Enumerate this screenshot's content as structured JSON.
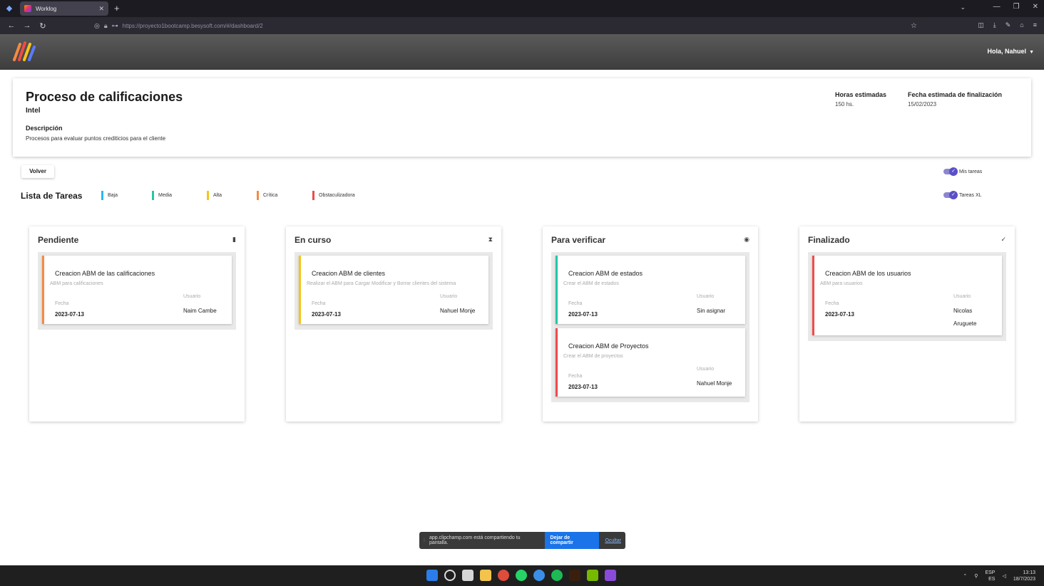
{
  "browser": {
    "tab_title": "Worklog",
    "url": "https://proyecto1bootcamp.besysoft.com/#/dashboard/2"
  },
  "header": {
    "greeting": "Hola, Nahuel"
  },
  "project": {
    "title": "Proceso de calificaciones",
    "client": "Intel",
    "description_label": "Descripción",
    "description": "Procesos para evaluar puntos crediticios para el cliente",
    "hours_label": "Horas estimadas",
    "hours_value": "150 hs.",
    "end_label": "Fecha estimada de finalización",
    "end_value": "15/02/2023"
  },
  "actions": {
    "back_label": "Volver"
  },
  "task_list": {
    "title": "Lista de Tareas",
    "legend": [
      {
        "label": "Baja",
        "color": "#29b6f6"
      },
      {
        "label": "Media",
        "color": "#26c6a6"
      },
      {
        "label": "Alta",
        "color": "#f5c518"
      },
      {
        "label": "Crítica",
        "color": "#f58a42"
      },
      {
        "label": "Obstaculizadora",
        "color": "#ef4b4b"
      }
    ],
    "toggle_my_tasks": "Mis tareas",
    "toggle_xl": "Tareas XL"
  },
  "columns": [
    {
      "title": "Pendiente",
      "icon": "file-icon",
      "tasks": [
        {
          "title": "Creacion ABM de las calificaciones",
          "desc": "ABM para calificaciones",
          "date_label": "Fecha",
          "date": "2023-07-13",
          "user_label": "Usuario",
          "user": "Naim Cambe",
          "color": "#f58a42"
        }
      ]
    },
    {
      "title": "En curso",
      "icon": "hourglass-icon",
      "tasks": [
        {
          "title": "Creacion ABM de clientes",
          "desc": "Realizar el ABM para Cargar Modificar y Borrar clientes del sistema",
          "date_label": "Fecha",
          "date": "2023-07-13",
          "user_label": "Usuario",
          "user": "Nahuel Monje",
          "color": "#f5c518"
        }
      ]
    },
    {
      "title": "Para verificar",
      "icon": "eye-icon",
      "tasks": [
        {
          "title": "Creacion ABM de estados",
          "desc": "Crear el ABM de estados",
          "date_label": "Fecha",
          "date": "2023-07-13",
          "user_label": "Usuario",
          "user": "Sin asignar",
          "color": "#26c6a6"
        },
        {
          "title": "Creacion ABM de Proyectos",
          "desc": "Crear el ABM de proyectos",
          "date_label": "Fecha",
          "date": "2023-07-13",
          "user_label": "Usuario",
          "user": "Nahuel Monje",
          "color": "#ef4b4b"
        }
      ]
    },
    {
      "title": "Finalizado",
      "icon": "check-icon",
      "tasks": [
        {
          "title": "Creacion ABM de los usuarios",
          "desc": "ABM para usuarios",
          "date_label": "Fecha",
          "date": "2023-07-13",
          "user_label": "Usuario",
          "user": "Nicolas Aruguete",
          "color": "#ef4b4b"
        }
      ]
    }
  ],
  "screenshare": {
    "message": "app.clipchamp.com está compartiendo tu pantalla.",
    "stop_label": "Dejar de compartir",
    "hide_label": "Ocultar"
  },
  "taskbar": {
    "lang": "ESP",
    "region": "ES",
    "time": "13:13",
    "date": "18/7/2023"
  }
}
